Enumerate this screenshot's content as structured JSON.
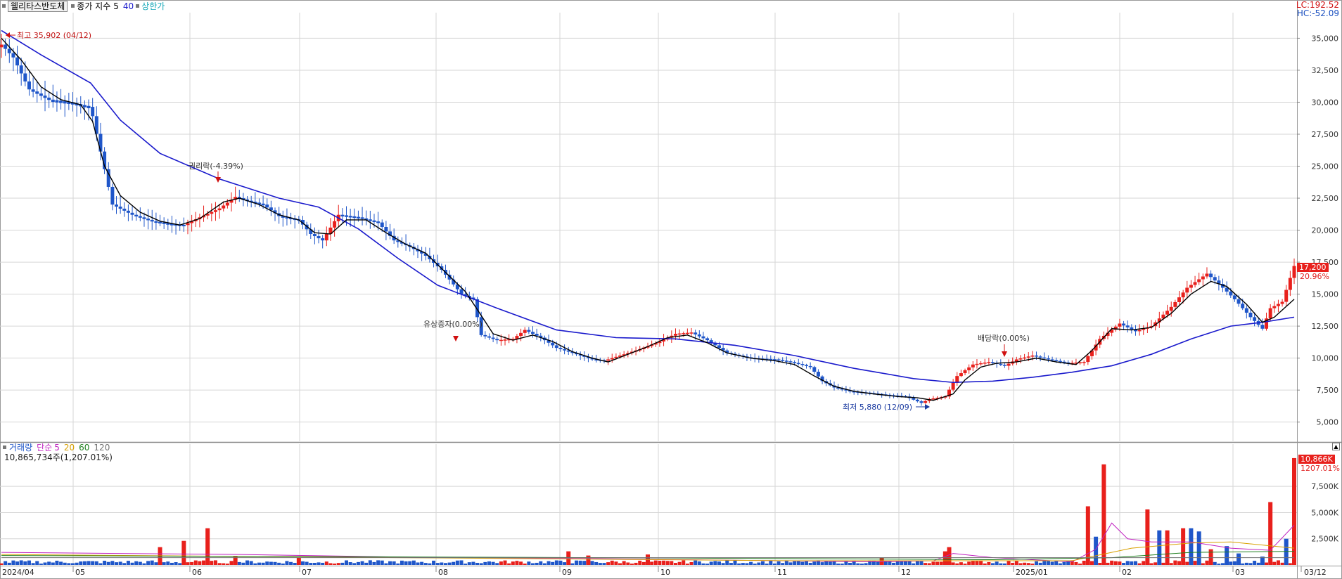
{
  "header": {
    "stock_name": "웰리타스반도체",
    "indicator": "종가 지수",
    "ma_short": "5",
    "ma_long": "40",
    "upper_limit": "상한가",
    "lc": "LC:192.52",
    "hc": "HC:-52.09"
  },
  "price_axis": {
    "labels": [
      "35,000",
      "32,500",
      "30,000",
      "27,500",
      "25,000",
      "22,500",
      "20,000",
      "17,500",
      "15,000",
      "12,500",
      "10,000",
      "7,500",
      "5,000"
    ],
    "current_price": "17,200",
    "current_change": "20.96%"
  },
  "annotations": {
    "high": "최고 35,902 (04/12)",
    "low": "최저 5,880 (12/09)",
    "rights": "권리락(-4.39%)",
    "paid_in": "유상증자(0.00%)",
    "dividend": "배당락(0.00%)"
  },
  "volume_header": {
    "label": "거래량",
    "simple": "단순",
    "p5": "5",
    "p20": "20",
    "p60": "60",
    "p120": "120",
    "total": "10,865,734주(1,207.01%)"
  },
  "volume_axis": {
    "labels": [
      "7,500K",
      "5,000K",
      "2,500K"
    ],
    "current_volume": "10,866K",
    "current_pct": "1207.01%"
  },
  "date_axis": {
    "labels": [
      "2024/04",
      "05",
      "06",
      "07",
      "08",
      "09",
      "10",
      "11",
      "12",
      "2025/01",
      "02",
      "03",
      "03/12"
    ]
  },
  "colors": {
    "up": "#e8201c",
    "down": "#1f56c9",
    "ma5": "#000000",
    "ma40": "#1a1acc",
    "grid": "#d6d6d6"
  },
  "chart_data": {
    "type": "candlestick",
    "price_range": [
      3500,
      37000
    ],
    "volume_range": [
      0,
      11000
    ],
    "close_path": [
      [
        0,
        34500
      ],
      [
        6,
        33500
      ],
      [
        14,
        31000
      ],
      [
        24,
        30200
      ],
      [
        34,
        30000
      ],
      [
        45,
        29600
      ],
      [
        56,
        22000
      ],
      [
        66,
        21200
      ],
      [
        76,
        20700
      ],
      [
        84,
        20500
      ],
      [
        92,
        20400
      ],
      [
        100,
        21000
      ],
      [
        110,
        21700
      ],
      [
        118,
        22600
      ],
      [
        124,
        22300
      ],
      [
        132,
        22000
      ],
      [
        140,
        21100
      ],
      [
        150,
        20800
      ],
      [
        156,
        19700
      ],
      [
        162,
        19200
      ],
      [
        170,
        21200
      ],
      [
        180,
        21000
      ],
      [
        190,
        20600
      ],
      [
        198,
        19200
      ],
      [
        206,
        18700
      ],
      [
        214,
        18000
      ],
      [
        222,
        16900
      ],
      [
        232,
        15000
      ],
      [
        238,
        14600
      ],
      [
        242,
        11800
      ],
      [
        250,
        11400
      ],
      [
        258,
        11500
      ],
      [
        264,
        12200
      ],
      [
        272,
        11600
      ],
      [
        280,
        10800
      ],
      [
        290,
        10300
      ],
      [
        298,
        9900
      ],
      [
        304,
        9800
      ],
      [
        312,
        10200
      ],
      [
        322,
        10700
      ],
      [
        332,
        11300
      ],
      [
        340,
        11900
      ],
      [
        348,
        12000
      ],
      [
        356,
        11400
      ],
      [
        366,
        10400
      ],
      [
        378,
        10000
      ],
      [
        390,
        9900
      ],
      [
        398,
        9700
      ],
      [
        408,
        9300
      ],
      [
        414,
        8200
      ],
      [
        420,
        7700
      ],
      [
        428,
        7400
      ],
      [
        436,
        7300
      ],
      [
        448,
        7100
      ],
      [
        456,
        7000
      ],
      [
        464,
        6500
      ],
      [
        468,
        6800
      ],
      [
        476,
        7000
      ],
      [
        482,
        8600
      ],
      [
        490,
        9500
      ],
      [
        498,
        9700
      ],
      [
        506,
        9400
      ],
      [
        512,
        9900
      ],
      [
        520,
        10200
      ],
      [
        528,
        9900
      ],
      [
        538,
        9600
      ],
      [
        546,
        9700
      ],
      [
        554,
        11500
      ],
      [
        564,
        12700
      ],
      [
        572,
        12100
      ],
      [
        580,
        12500
      ],
      [
        590,
        14000
      ],
      [
        598,
        15500
      ],
      [
        608,
        16600
      ],
      [
        614,
        15800
      ],
      [
        622,
        14600
      ],
      [
        630,
        13200
      ],
      [
        636,
        12300
      ],
      [
        640,
        13900
      ],
      [
        646,
        14400
      ],
      [
        652,
        17200
      ]
    ],
    "ma40_path": [
      [
        0,
        35600
      ],
      [
        20,
        33700
      ],
      [
        45,
        31500
      ],
      [
        60,
        28600
      ],
      [
        80,
        26000
      ],
      [
        110,
        24000
      ],
      [
        140,
        22500
      ],
      [
        160,
        21800
      ],
      [
        180,
        20100
      ],
      [
        200,
        17800
      ],
      [
        220,
        15700
      ],
      [
        250,
        13900
      ],
      [
        280,
        12200
      ],
      [
        310,
        11600
      ],
      [
        340,
        11500
      ],
      [
        370,
        11000
      ],
      [
        400,
        10200
      ],
      [
        430,
        9200
      ],
      [
        460,
        8400
      ],
      [
        480,
        8100
      ],
      [
        500,
        8200
      ],
      [
        520,
        8500
      ],
      [
        540,
        8900
      ],
      [
        560,
        9400
      ],
      [
        580,
        10300
      ],
      [
        600,
        11500
      ],
      [
        620,
        12500
      ],
      [
        636,
        12800
      ],
      [
        652,
        13200
      ]
    ],
    "ma5_path": [
      [
        0,
        35000
      ],
      [
        10,
        33300
      ],
      [
        20,
        31200
      ],
      [
        30,
        30200
      ],
      [
        40,
        29800
      ],
      [
        46,
        28500
      ],
      [
        52,
        25000
      ],
      [
        60,
        22700
      ],
      [
        70,
        21400
      ],
      [
        80,
        20700
      ],
      [
        90,
        20400
      ],
      [
        100,
        20900
      ],
      [
        112,
        22200
      ],
      [
        120,
        22500
      ],
      [
        130,
        22000
      ],
      [
        140,
        21200
      ],
      [
        150,
        20800
      ],
      [
        158,
        19800
      ],
      [
        166,
        19700
      ],
      [
        174,
        20800
      ],
      [
        184,
        20800
      ],
      [
        194,
        19800
      ],
      [
        204,
        18900
      ],
      [
        214,
        18200
      ],
      [
        224,
        16700
      ],
      [
        234,
        15200
      ],
      [
        240,
        13800
      ],
      [
        248,
        11900
      ],
      [
        258,
        11400
      ],
      [
        268,
        11800
      ],
      [
        278,
        11300
      ],
      [
        288,
        10500
      ],
      [
        298,
        10000
      ],
      [
        306,
        9700
      ],
      [
        316,
        10300
      ],
      [
        326,
        10900
      ],
      [
        336,
        11600
      ],
      [
        346,
        11800
      ],
      [
        356,
        11200
      ],
      [
        366,
        10400
      ],
      [
        378,
        10000
      ],
      [
        390,
        9800
      ],
      [
        400,
        9500
      ],
      [
        410,
        8600
      ],
      [
        420,
        7800
      ],
      [
        430,
        7400
      ],
      [
        440,
        7200
      ],
      [
        452,
        7000
      ],
      [
        462,
        6900
      ],
      [
        470,
        6700
      ],
      [
        480,
        7200
      ],
      [
        486,
        8300
      ],
      [
        494,
        9300
      ],
      [
        502,
        9600
      ],
      [
        512,
        9700
      ],
      [
        522,
        10000
      ],
      [
        532,
        9700
      ],
      [
        542,
        9500
      ],
      [
        550,
        10600
      ],
      [
        560,
        12300
      ],
      [
        570,
        12200
      ],
      [
        580,
        12400
      ],
      [
        590,
        13500
      ],
      [
        600,
        15000
      ],
      [
        610,
        16000
      ],
      [
        618,
        15600
      ],
      [
        628,
        14200
      ],
      [
        636,
        12800
      ],
      [
        642,
        13200
      ],
      [
        652,
        14600
      ]
    ],
    "total_bars": 653,
    "upper_bars": [
      {
        "i": 80,
        "v": 1700
      },
      {
        "i": 92,
        "v": 2300
      },
      {
        "i": 104,
        "v": 3500
      },
      {
        "i": 118,
        "v": 800
      },
      {
        "i": 150,
        "v": 700
      },
      {
        "i": 286,
        "v": 1300
      },
      {
        "i": 296,
        "v": 900
      },
      {
        "i": 326,
        "v": 1000
      },
      {
        "i": 444,
        "v": 700
      },
      {
        "i": 476,
        "v": 1300
      },
      {
        "i": 478,
        "v": 1700
      },
      {
        "i": 548,
        "v": 5600
      },
      {
        "i": 556,
        "v": 9600
      },
      {
        "i": 578,
        "v": 5300
      },
      {
        "i": 588,
        "v": 3300
      },
      {
        "i": 596,
        "v": 3500
      },
      {
        "i": 610,
        "v": 1500
      },
      {
        "i": 640,
        "v": 6000
      },
      {
        "i": 652,
        "v": 10200
      }
    ],
    "down_bars": [
      {
        "i": 552,
        "v": 2700
      },
      {
        "i": 584,
        "v": 3300
      },
      {
        "i": 600,
        "v": 3500
      },
      {
        "i": 604,
        "v": 3200
      },
      {
        "i": 618,
        "v": 1800
      },
      {
        "i": 624,
        "v": 1100
      },
      {
        "i": 636,
        "v": 800
      },
      {
        "i": 648,
        "v": 2500
      }
    ],
    "vol_ma": [
      {
        "color": "#c020c0",
        "pts": [
          [
            0,
            1200
          ],
          [
            120,
            1000
          ],
          [
            220,
            700
          ],
          [
            300,
            600
          ],
          [
            440,
            300
          ],
          [
            470,
            400
          ],
          [
            480,
            1100
          ],
          [
            500,
            700
          ],
          [
            540,
            300
          ],
          [
            552,
            1500
          ],
          [
            560,
            4000
          ],
          [
            568,
            2500
          ],
          [
            580,
            2200
          ],
          [
            600,
            2200
          ],
          [
            620,
            1600
          ],
          [
            640,
            1400
          ],
          [
            652,
            3800
          ]
        ]
      },
      {
        "color": "#d8a000",
        "pts": [
          [
            0,
            1000
          ],
          [
            200,
            700
          ],
          [
            400,
            400
          ],
          [
            540,
            400
          ],
          [
            570,
            1600
          ],
          [
            600,
            2100
          ],
          [
            620,
            2200
          ],
          [
            652,
            1600
          ]
        ]
      },
      {
        "color": "#208020",
        "pts": [
          [
            0,
            900
          ],
          [
            300,
            700
          ],
          [
            500,
            500
          ],
          [
            560,
            700
          ],
          [
            600,
            1200
          ],
          [
            652,
            1300
          ]
        ]
      },
      {
        "color": "#707070",
        "pts": [
          [
            0,
            700
          ],
          [
            652,
            700
          ]
        ]
      }
    ]
  }
}
